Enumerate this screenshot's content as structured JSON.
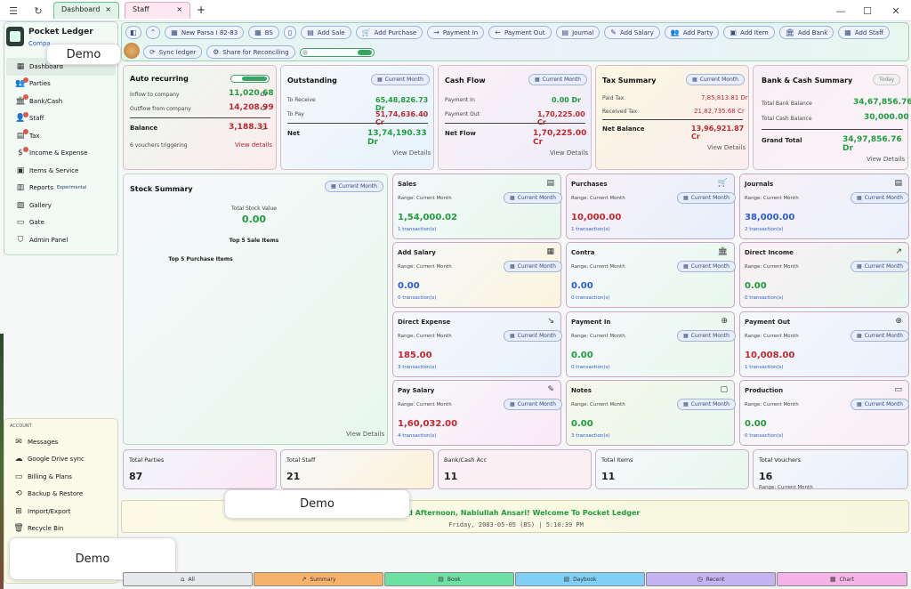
{
  "topbar": {
    "tabs": [
      {
        "label": "Dashboard",
        "close": "×"
      },
      {
        "label": "Staff",
        "close": "×"
      }
    ],
    "new_tab": "+"
  },
  "toolbar": {
    "company": "New Parsa I 82-83",
    "lang": "BS",
    "buttons": [
      "Add Sale",
      "Add Purchase",
      "Payment In",
      "Payment Out",
      "Journal",
      "Add Salary",
      "Add Party",
      "Add Item",
      "Add Bank",
      "Add Staff"
    ],
    "sync_ledger": "Sync ledger",
    "share": "Share for Reconciling"
  },
  "sidebar": {
    "app_name": "Pocket Ledger",
    "company_label": "Compa",
    "items": [
      {
        "label": "Dashboard",
        "icon": "grid-icon"
      },
      {
        "label": "Parties",
        "icon": "users-icon"
      },
      {
        "label": "Bank/Cash",
        "icon": "bank-icon"
      },
      {
        "label": "Staff",
        "icon": "staff-icon"
      },
      {
        "label": "Tax",
        "icon": "tax-icon"
      },
      {
        "label": "Income & Expense",
        "icon": "dollar-icon"
      },
      {
        "label": "Items & Service",
        "icon": "box-icon"
      },
      {
        "label": "Reports",
        "icon": "report-icon",
        "tag": "Experimental"
      },
      {
        "label": "Gallery",
        "icon": "image-icon"
      },
      {
        "label": "Gate",
        "icon": "gate-icon"
      },
      {
        "label": "Admin Panel",
        "icon": "shield-icon"
      }
    ]
  },
  "account": {
    "header": "ACCOUNT",
    "items": [
      {
        "label": "Messages",
        "icon": "mail-icon"
      },
      {
        "label": "Google Drive sync",
        "icon": "cloud-icon"
      },
      {
        "label": "Billing & Plans",
        "icon": "card-icon"
      },
      {
        "label": "Backup & Restore",
        "icon": "backup-icon"
      },
      {
        "label": "Import/Export",
        "icon": "table-icon"
      },
      {
        "label": "Recycle Bin",
        "icon": "bin-icon"
      }
    ]
  },
  "demo": "Demo",
  "auto": {
    "title": "Auto recurring",
    "inflow_label": "Inflow to company",
    "inflow": "11,020.68",
    "inflow_suffix": "Dr",
    "outflow_label": "Outflow from company",
    "outflow": "14,208.99",
    "outflow_suffix": "Cr",
    "balance_label": "Balance",
    "balance": "3,188.31",
    "balance_suffix": "Cr",
    "vouchers": "6 vouchers triggering",
    "details": "View details"
  },
  "outstanding": {
    "title": "Outstanding",
    "pill": "Current Month",
    "receive_label": "To Receive",
    "receive": "65,48,826.73 Dr",
    "pay_label": "To Pay",
    "pay": "51,74,636.40 Cr",
    "net_label": "Net",
    "net": "13,74,190.33 Dr",
    "details": "View Details"
  },
  "cashflow": {
    "title": "Cash Flow",
    "pill": "Current Month",
    "in_label": "Payment In",
    "in": "0.00 Dr",
    "out_label": "Payment Out",
    "out": "1,70,225.00 Cr",
    "net_label": "Net Flow",
    "net": "1,70,225.00 Cr",
    "details": "View Details"
  },
  "tax": {
    "title": "Tax Summary",
    "pill": "Current Month",
    "paid_label": "Paid Tax",
    "paid": "7,85,813.81 Dr",
    "received_label": "Received Tax",
    "received": "21,82,735.68 Cr",
    "net_label": "Net Balance",
    "net": "13,96,921.87 Cr",
    "details": "View Details"
  },
  "bank": {
    "title": "Bank & Cash Summary",
    "pill": "Today",
    "bank_label": "Total Bank Balance",
    "bank": "34,67,856.76",
    "cash_label": "Total Cash Balance",
    "cash": "30,000.00",
    "grand_label": "Grand Total",
    "grand": "34,97,856.76 Dr",
    "details": "View Details"
  },
  "stock": {
    "title": "Stock Summary",
    "pill": "Current Month",
    "value_label": "Total Stock Value",
    "value": "0.00",
    "top_sale": "Top 5 Sale Items",
    "top_purchase": "Top 5 Purchase Items",
    "details": "View Details"
  },
  "tiles": [
    {
      "title": "Sales",
      "range": "Range: Current Month",
      "pill": "Current Month",
      "value": "1,54,000.02",
      "color": "#1f9d3c",
      "count": "1 transaction(s)",
      "icon": "receipt-icon"
    },
    {
      "title": "Purchases",
      "range": "Range: Current Month",
      "pill": "Current Month",
      "value": "10,000.00",
      "color": "#c0272d",
      "count": "1 transaction(s)",
      "icon": "cart-icon"
    },
    {
      "title": "Journals",
      "range": "Range: Current Month",
      "pill": "Current Month",
      "value": "38,000.00",
      "color": "#2a5bd7",
      "count": "2 transaction(s)",
      "icon": "book-icon"
    },
    {
      "title": "Add Salary",
      "range": "Range: Current Month",
      "pill": "Current Month",
      "value": "0.00",
      "color": "#2a5bd7",
      "count": "0 transaction(s)",
      "icon": "salary-icon"
    },
    {
      "title": "Contra",
      "range": "Range: Current Month",
      "pill": "Current Month",
      "value": "0.00",
      "color": "#2a5bd7",
      "count": "0 transaction(s)",
      "icon": "bank-icon"
    },
    {
      "title": "Direct Income",
      "range": "Range: Current Month",
      "pill": "Current Month",
      "value": "0.00",
      "color": "#1f9d3c",
      "count": "0 transaction(s)",
      "icon": "trend-up-icon"
    },
    {
      "title": "Direct Expense",
      "range": "Range: Current Month",
      "pill": "Current Month",
      "value": "185.00",
      "color": "#c0272d",
      "count": "3 transaction(s)",
      "icon": "trend-down-icon"
    },
    {
      "title": "Payment In",
      "range": "Range: Current Month",
      "pill": "Current Month",
      "value": "0.00",
      "color": "#1f9d3c",
      "count": "0 transaction(s)",
      "icon": "arrow-down-circle-icon"
    },
    {
      "title": "Payment Out",
      "range": "Range: Current Month",
      "pill": "Current Month",
      "value": "10,008.00",
      "color": "#c0272d",
      "count": "1 transaction(s)",
      "icon": "arrow-up-circle-icon"
    },
    {
      "title": "Pay Salary",
      "range": "Range: Current Month",
      "pill": "Current Month",
      "value": "1,60,032.00",
      "color": "#c0272d",
      "count": "4 transaction(s)",
      "icon": "pay-icon"
    },
    {
      "title": "Notes",
      "range": "Range: Current Month",
      "pill": "Current Month",
      "value": "0.00",
      "color": "#1f9d3c",
      "count": "3 transaction(s)",
      "icon": "note-icon"
    },
    {
      "title": "Production",
      "range": "Range: Current Month",
      "pill": "Current Month",
      "value": "0.00",
      "color": "#1f9d3c",
      "count": "0 transaction(s)",
      "icon": "folder-icon"
    }
  ],
  "totals": [
    {
      "label": "Total Parties",
      "value": "87"
    },
    {
      "label": "Total Staff",
      "value": "21"
    },
    {
      "label": "Bank/Cash Acc",
      "value": "11"
    },
    {
      "label": "Total Items",
      "value": "11"
    },
    {
      "label": "Total Vouchers",
      "value": "16",
      "sub": "Range: Current Month"
    }
  ],
  "greeting": {
    "text": "Good Afternoon, Nabiullah Ansari! Welcome To Pocket Ledger",
    "date": "Friday, 2083-05-05 (BS) | 5:10:39 PM"
  },
  "bottom_tabs": [
    {
      "label": "All",
      "icon": "home-icon",
      "bg": "#e6e8ec"
    },
    {
      "label": "Summary",
      "icon": "trend-icon",
      "bg": "#f7b26a"
    },
    {
      "label": "Book",
      "icon": "book-icon",
      "bg": "#6fe0a4"
    },
    {
      "label": "Daybook",
      "icon": "daybook-icon",
      "bg": "#7fd0f4"
    },
    {
      "label": "Recent",
      "icon": "clock-icon",
      "bg": "#c5b3f2"
    },
    {
      "label": "Chart",
      "icon": "chart-icon",
      "bg": "#f5b4e8"
    }
  ]
}
